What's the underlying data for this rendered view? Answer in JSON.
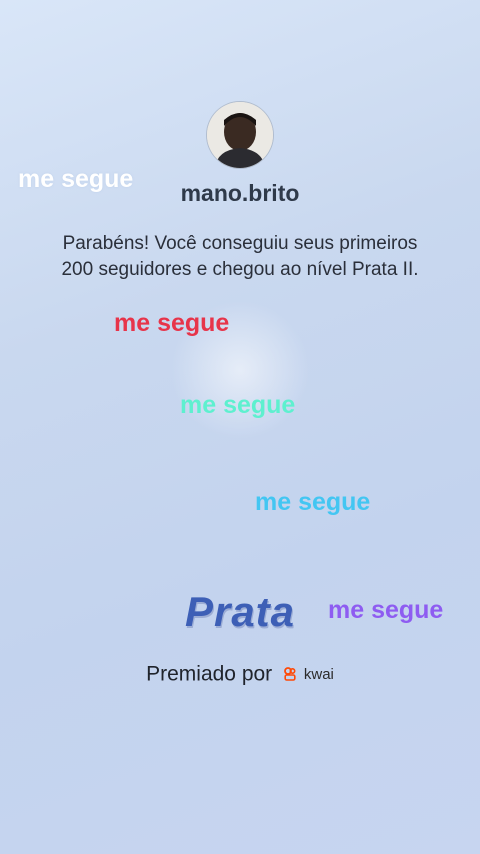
{
  "profile": {
    "username": "mano.brito",
    "avatar_icon": "user-avatar-photo"
  },
  "message": "Parabéns! Você conseguiu seus primeiros 200 seguidores e chegou ao nível Prata II.",
  "overlay_tags": [
    {
      "text": "me segue",
      "color": "#ffffff"
    },
    {
      "text": "me segue",
      "color": "#e7344a"
    },
    {
      "text": "me segue",
      "color": "#5ef0cf"
    },
    {
      "text": "me segue",
      "color": "#43c6f2"
    },
    {
      "text": "me segue",
      "color": "#8e5cf1"
    }
  ],
  "tier": {
    "label": "Prata",
    "color": "#3d5fb6"
  },
  "awarded": {
    "label": "Premiado por",
    "brand": "kwai",
    "brand_color": "#ff4906",
    "brand_icon": "kwai-logo-icon"
  }
}
